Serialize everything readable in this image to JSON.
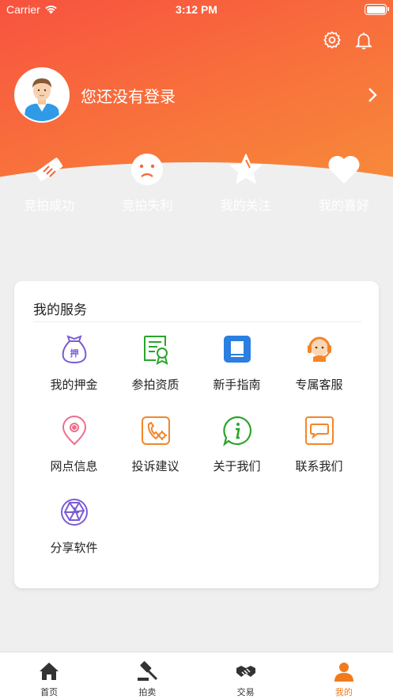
{
  "status": {
    "carrier": "Carrier",
    "time": "3:12 PM"
  },
  "profile": {
    "login_text": "您还没有登录"
  },
  "quick": [
    {
      "label": "竞拍成功",
      "icon": "handshake-icon"
    },
    {
      "label": "竞拍失利",
      "icon": "sad-face-icon"
    },
    {
      "label": "我的关注",
      "icon": "star-icon"
    },
    {
      "label": "我的喜好",
      "icon": "heart-icon"
    }
  ],
  "services": {
    "title": "我的服务",
    "items": [
      {
        "label": "我的押金",
        "icon": "deposit-bag-icon",
        "color": "#7b5cd6"
      },
      {
        "label": "参拍资质",
        "icon": "certificate-icon",
        "color": "#2aa52a"
      },
      {
        "label": "新手指南",
        "icon": "guide-book-icon",
        "color": "#2a7fe0"
      },
      {
        "label": "专属客服",
        "icon": "customer-service-icon",
        "color": "#f2862a"
      },
      {
        "label": "网点信息",
        "icon": "location-pin-icon",
        "color": "#ef6d8a"
      },
      {
        "label": "投诉建议",
        "icon": "complaint-phone-icon",
        "color": "#f2862a"
      },
      {
        "label": "关于我们",
        "icon": "info-icon",
        "color": "#2aa52a"
      },
      {
        "label": "联系我们",
        "icon": "message-icon",
        "color": "#f2862a"
      },
      {
        "label": "分享软件",
        "icon": "share-aperture-icon",
        "color": "#7b5cd6"
      }
    ]
  },
  "tabs": [
    {
      "label": "首页",
      "icon": "home-icon",
      "active": false
    },
    {
      "label": "拍卖",
      "icon": "gavel-icon",
      "active": false
    },
    {
      "label": "交易",
      "icon": "handshake-icon",
      "active": false
    },
    {
      "label": "我的",
      "icon": "user-icon",
      "active": true
    }
  ],
  "colors": {
    "accent": "#f17b1b",
    "header_start": "#f7523f",
    "header_end": "#f69238"
  }
}
